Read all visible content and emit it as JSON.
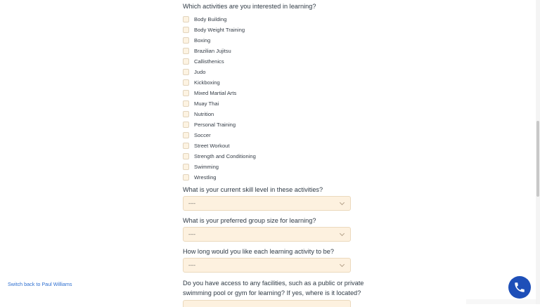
{
  "activities": {
    "question": "Which activities are you interested in learning?",
    "options": [
      "Body Building",
      "Body Weight Training",
      "Boxing",
      "Brazilian Jujitsu",
      "Callisthenics",
      "Judo",
      "Kickboxing",
      "Mixed Martial Arts",
      "Muay Thai",
      "Nutrition",
      "Personal Training",
      "Soccer",
      "Street Workout",
      "Strength and Conditioning",
      "Swimming",
      "Wrestling"
    ]
  },
  "skill_level": {
    "question": "What is your current skill level in these activities?",
    "value": "----"
  },
  "group_size": {
    "question": "What is your preferred group size for learning?",
    "value": "----"
  },
  "duration": {
    "question": "How long would you like each learning activity to be?",
    "value": "----"
  },
  "facilities": {
    "question_line1": "Do you have access to any facilities, such as a public or private",
    "question_line2": "swimming pool or gym for learning? If yes, where is it located?"
  },
  "switch_link": "Switch back to Paul Williams",
  "icons": {
    "call": "phone-icon",
    "chevron": "chevron-down-icon"
  },
  "colors": {
    "accent": "#1e4fb8",
    "field_bg": "#fdf1df",
    "link": "#2e6fd0"
  }
}
